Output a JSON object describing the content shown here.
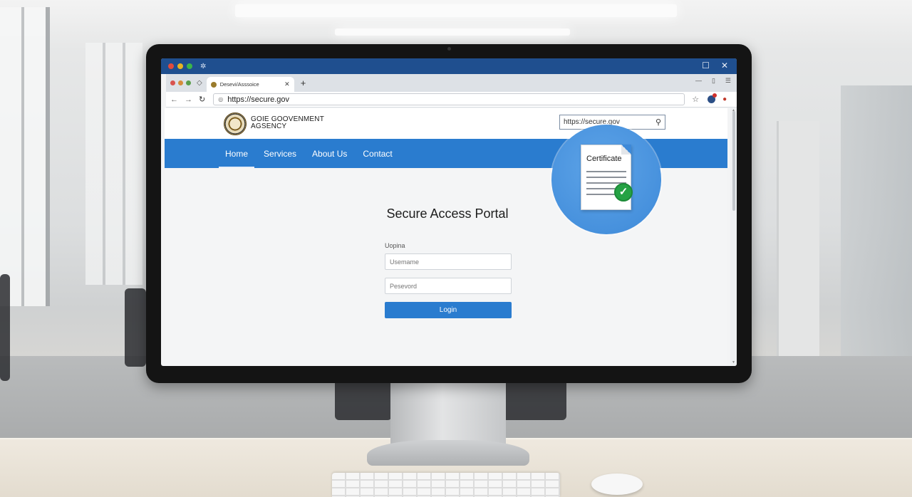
{
  "browser": {
    "tab_title": "Desevi/Asssoice",
    "tab_close": "✕",
    "new_tab": "+",
    "address_url": "https://secure.gov"
  },
  "site": {
    "agency_line1": "GOIE GOOVENMENT",
    "agency_line2": "AGSENCY",
    "search_value": "https://secure.gov",
    "nav": [
      {
        "label": "Home",
        "active": true
      },
      {
        "label": "Services"
      },
      {
        "label": "About Us"
      },
      {
        "label": "Contact"
      }
    ],
    "portal_title": "Secure Access Portal",
    "form_label": "Uopina",
    "username_placeholder": "Usemame",
    "password_placeholder": "Pesevord",
    "login_label": "Login"
  },
  "certificate": {
    "title": "Certificate"
  },
  "colors": {
    "titlebar": "#1f4f8f",
    "nav_blue": "#2a7ccf",
    "cert_circle": "#3d89d8",
    "check_green": "#25a244"
  },
  "icons": {
    "back": "back-arrow-icon",
    "forward": "forward-arrow-icon",
    "reload": "reload-icon",
    "lock": "lock-icon",
    "star": "star-icon",
    "search": "search-icon",
    "check": "check-icon"
  }
}
